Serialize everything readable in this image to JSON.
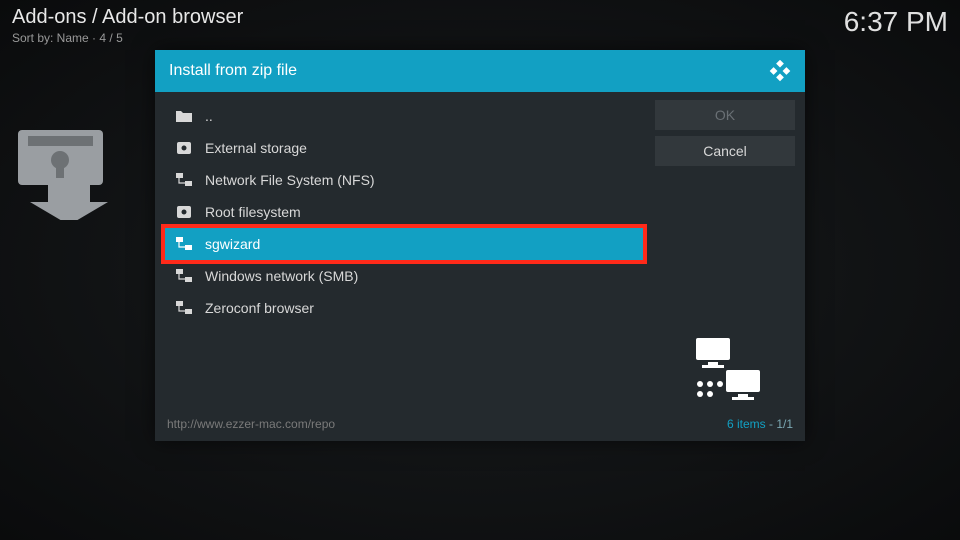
{
  "header": {
    "breadcrumb": "Add-ons / Add-on browser",
    "sort_label": "Sort by: Name",
    "position": "4 / 5",
    "clock": "6:37 PM"
  },
  "dialog": {
    "title": "Install from zip file",
    "items": [
      {
        "label": "..",
        "icon": "folder-up",
        "selected": false,
        "highlight": false
      },
      {
        "label": "External storage",
        "icon": "disk",
        "selected": false,
        "highlight": false
      },
      {
        "label": "Network File System (NFS)",
        "icon": "network",
        "selected": false,
        "highlight": false
      },
      {
        "label": "Root filesystem",
        "icon": "disk",
        "selected": false,
        "highlight": false
      },
      {
        "label": "sgwizard",
        "icon": "network",
        "selected": true,
        "highlight": true
      },
      {
        "label": "Windows network (SMB)",
        "icon": "network",
        "selected": false,
        "highlight": false
      },
      {
        "label": "Zeroconf browser",
        "icon": "network",
        "selected": false,
        "highlight": false
      }
    ],
    "buttons": {
      "ok": "OK",
      "cancel": "Cancel"
    },
    "footer": {
      "path": "http://www.ezzer-mac.com/repo",
      "count_label": "6 items",
      "page": "1/1"
    }
  },
  "colors": {
    "accent": "#12a0c3",
    "highlight": "#ff2a1a"
  }
}
